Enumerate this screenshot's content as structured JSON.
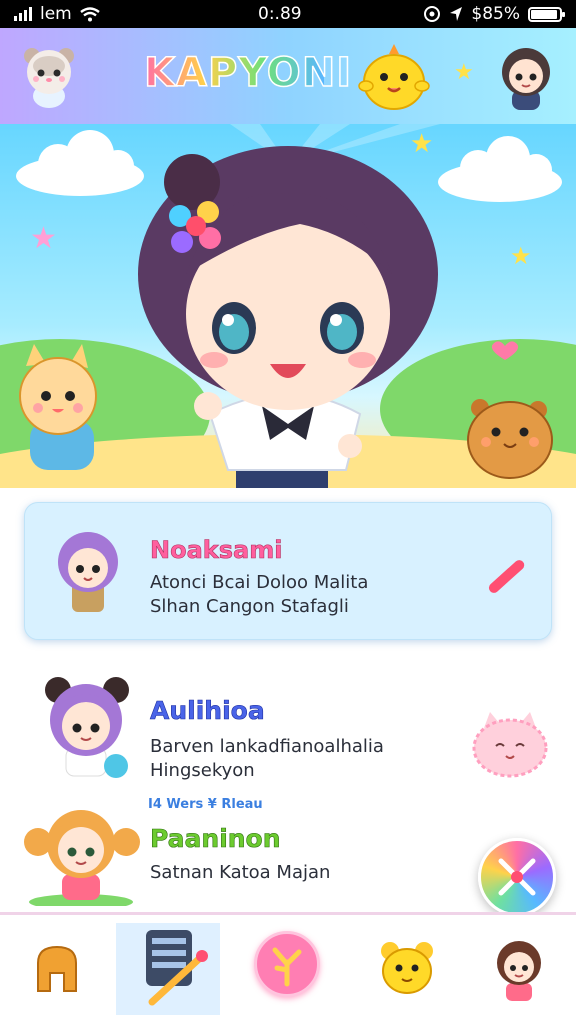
{
  "status_bar": {
    "carrier": "lem",
    "time": "0:.89",
    "battery_percent": "$85%"
  },
  "header": {
    "title": "KAPYONI"
  },
  "characters": [
    {
      "name": "Noaksami",
      "line1": "Atonci Bcai Doloo Malita",
      "line2": "Slhan Cangon Stafagli"
    },
    {
      "name": "Aulihioa",
      "line1": "Barven lankadfianoalhalia",
      "line2": "Hingsekyon"
    },
    {
      "meta": "I4 Wers ¥ Rleau",
      "name": "Paaninon",
      "line1": "Satnan Katoa Majan"
    }
  ],
  "bottom_nav": {
    "items": [
      "home-icon",
      "edit-tool-icon",
      "create-icon",
      "bear-friend-icon",
      "profile-icon"
    ]
  },
  "colors": {
    "accent_pink": "#ff7eb3",
    "accent_blue": "#4a64e8",
    "accent_green": "#6ccb2f",
    "card_bg": "#d8f1ff"
  }
}
